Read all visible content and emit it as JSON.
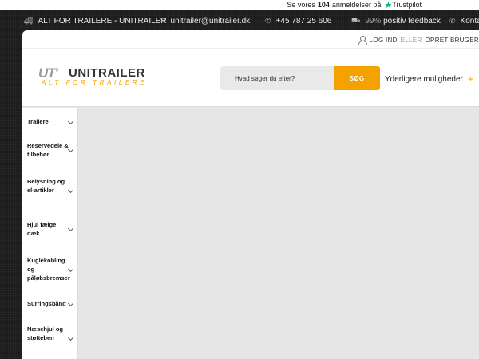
{
  "trustpilot": {
    "prefix": "Se vores",
    "count": "104",
    "suffix": "anmeldelser på",
    "brand": "Trustpilot"
  },
  "topbar": {
    "brand_text": "ALT FOR TRAILERE - UNITRAILER",
    "email": "unitrailer@unitrailer.dk",
    "phone": "+45 787 25 606",
    "feedback_percent": "99%",
    "feedback_text": "positiv feedback",
    "contact": "Kontakt"
  },
  "account": {
    "login": "LOG IND",
    "or": "ELLER",
    "register": "OPRET BRUGER"
  },
  "logo": {
    "mark": "UT'",
    "name": "UNITRAILER",
    "tagline": "ALT FOR TRAILERE"
  },
  "search": {
    "placeholder": "Hvad søger du efter?",
    "button": "SØG"
  },
  "more_options": "Yderligere muligheder",
  "nav": [
    {
      "label": "Trailere"
    },
    {
      "label": "Reservedele & tilbehør"
    },
    {
      "label": "Belysning og el-artikler"
    },
    {
      "label": "Hjul fælge dæk"
    },
    {
      "label": "Kuglekobling og påløbsbremser"
    },
    {
      "label": "Surringsbånd"
    },
    {
      "label": "Næsehjul og støtteben"
    }
  ],
  "colors": {
    "accent": "#f5a100",
    "trustpilot_green": "#00b67a",
    "dark_bg": "#1c1c1c"
  },
  "icons": [
    "truck-icon",
    "envelope-icon",
    "phone-icon",
    "delivery-icon",
    "phone-icon",
    "user-icon",
    "plus-icon",
    "star-icon",
    "chevron-down-icon"
  ]
}
